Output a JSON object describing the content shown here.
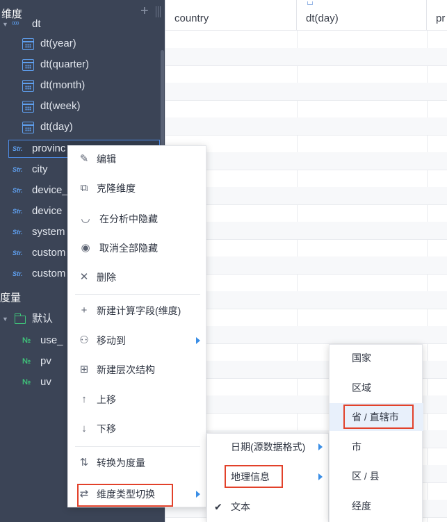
{
  "sidebar": {
    "dimensions_title": "维度",
    "measures_title": "度量",
    "hier_field": "dt",
    "date_fields": [
      "dt(year)",
      "dt(quarter)",
      "dt(month)",
      "dt(week)",
      "dt(day)"
    ],
    "str_fields": [
      "provinc",
      "city",
      "device_",
      "device",
      "system",
      "custom",
      "custom"
    ],
    "str_badge": "Str.",
    "num_badge": "№",
    "folder_label": "默认",
    "num_fields": [
      "use_",
      "pv",
      "uv"
    ]
  },
  "table": {
    "columns": [
      "country",
      "dt(day)",
      "pr"
    ]
  },
  "context_menu": {
    "items": [
      "编辑",
      "克隆维度",
      "在分析中隐藏",
      "取消全部隐藏",
      "删除",
      "新建计算字段(维度)",
      "移动到",
      "新建层次结构",
      "上移",
      "下移",
      "转换为度量",
      "维度类型切换"
    ]
  },
  "type_submenu": {
    "items": [
      "日期(源数据格式)",
      "地理信息",
      "文本"
    ]
  },
  "geo_submenu": {
    "items": [
      "国家",
      "区域",
      "省 / 直辖市",
      "市",
      "区 / 县",
      "经度"
    ]
  },
  "colors": {
    "sidebar_bg": "#3b4456",
    "accent_blue": "#3a8ee6",
    "highlight_red": "#e2412a",
    "measure_green": "#3fc47a"
  }
}
